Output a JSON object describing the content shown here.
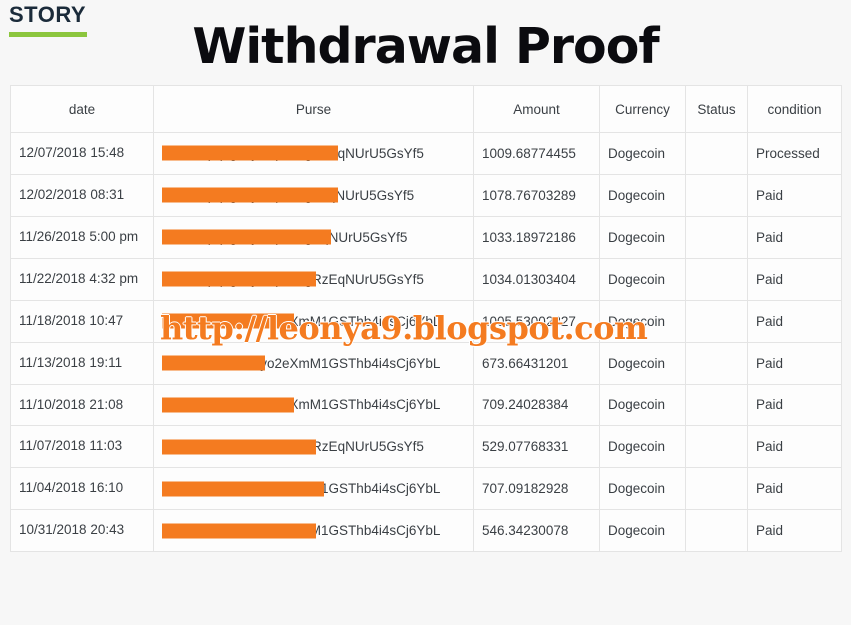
{
  "brand": {
    "label": "STORY",
    "rule_color": "#8cc63e",
    "text_color": "#1b2b3a"
  },
  "page_title": "Withdrawal Proof",
  "watermark": {
    "text": "http://leonya9.blogspot.com",
    "color": "#f47b20"
  },
  "colors": {
    "background": "#f7f7f7",
    "redaction": "#f47b20",
    "table_border": "#e4e4e4",
    "text": "#3a3f44"
  },
  "table": {
    "headers": [
      "date",
      "Purse",
      "Amount",
      "Currency",
      "Status",
      "condition"
    ],
    "rows": [
      {
        "date": "12/07/2018 15:48",
        "purse": "DEsviQpqJgcTykQpznagRzEqNUrU5GsYf5",
        "purse_redacted_chars": 24,
        "amount": "1009.68774455",
        "currency": "Dogecoin",
        "status": "",
        "condition": "Processed"
      },
      {
        "date": "12/02/2018 08:31",
        "purse": "DEsviQpqJgcTykQpznagzEqNUrU5GsYf5",
        "purse_redacted_chars": 24,
        "amount": "1078.76703289",
        "currency": "Dogecoin",
        "status": "",
        "condition": "Paid"
      },
      {
        "date": "11/26/2018 5:00 pm",
        "purse": "DEsviQpqJgcTykQpznagEqNUrU5GsYf5",
        "purse_redacted_chars": 23,
        "amount": "1033.18972186",
        "currency": "Dogecoin",
        "status": "",
        "condition": "Paid"
      },
      {
        "date": "11/22/2018 4:32 pm",
        "purse": "DEsviQpqJgcTykQpznagRzEqNUrU5GsYf5",
        "purse_redacted_chars": 21,
        "amount": "1034.01303404",
        "currency": "Dogecoin",
        "status": "",
        "condition": "Paid"
      },
      {
        "date": "11/18/2018 10:47",
        "purse": "DAbFEDRowSByo2eXmM1GSThb4i4sCj6YbL",
        "purse_redacted_chars": 18,
        "amount": "1005.53002827",
        "currency": "Dogecoin",
        "status": "",
        "condition": "Paid"
      },
      {
        "date": "11/13/2018 19:11",
        "purse": "DAbFEDRowSByo2eXmM1GSThb4i4sCj6YbL",
        "purse_redacted_chars": 14,
        "amount": "673.66431201",
        "currency": "Dogecoin",
        "status": "",
        "condition": "Paid"
      },
      {
        "date": "11/10/2018 21:08",
        "purse": "DAbFEDRowSByo2eXmM1GSThb4i4sCj6YbL",
        "purse_redacted_chars": 18,
        "amount": "709.24028384",
        "currency": "Dogecoin",
        "status": "",
        "condition": "Paid"
      },
      {
        "date": "11/07/2018 11:03",
        "purse": "DEsviQpqJgcTykQpznagRzEqNUrU5GsYf5",
        "purse_redacted_chars": 21,
        "amount": "529.07768331",
        "currency": "Dogecoin",
        "status": "",
        "condition": "Paid"
      },
      {
        "date": "11/04/2018 16:10",
        "purse": "DAbFEDRowSByo2eXmM1GSThb4i4sCj6YbL",
        "purse_redacted_chars": 22,
        "amount": "707.09182928",
        "currency": "Dogecoin",
        "status": "",
        "condition": "Paid"
      },
      {
        "date": "10/31/2018 20:43",
        "purse": "DAbFEDRowSByo2eXmM1GSThb4i4sCj6YbL",
        "purse_redacted_chars": 21,
        "amount": "546.34230078",
        "currency": "Dogecoin",
        "status": "",
        "condition": "Paid"
      }
    ]
  }
}
